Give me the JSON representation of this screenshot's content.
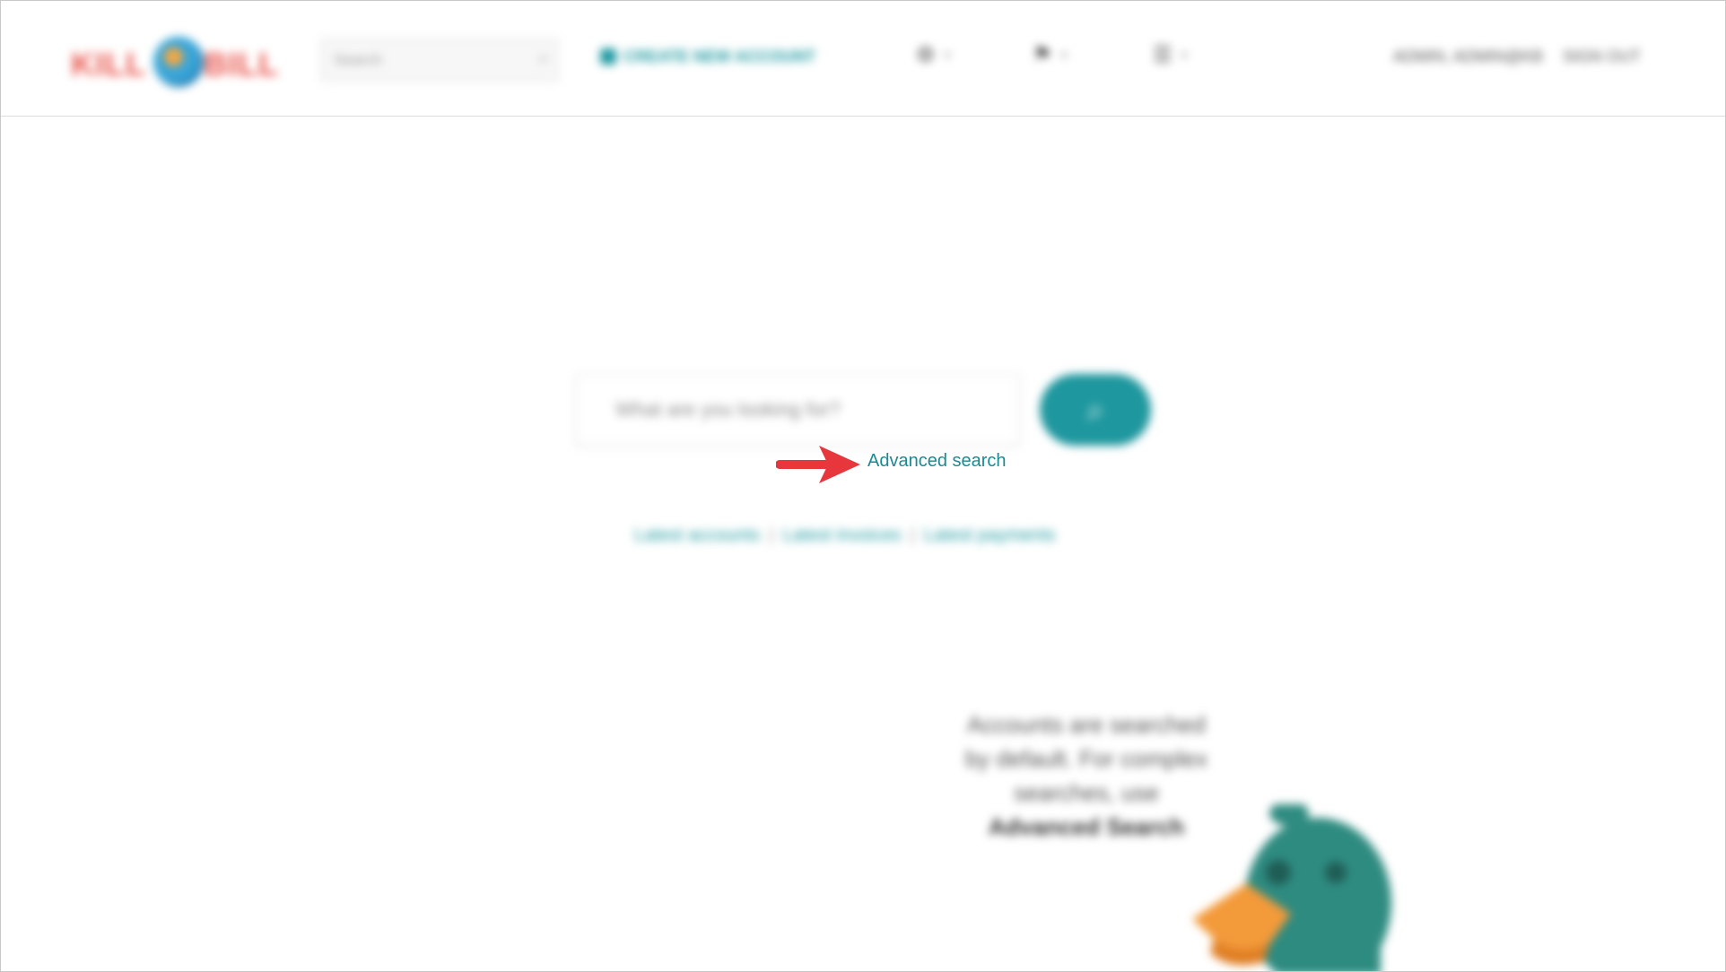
{
  "header": {
    "logo_left": "KILL",
    "logo_right": "BILL",
    "search_placeholder": "Search",
    "create_account_label": "CREATE NEW ACCOUNT",
    "user_label": "ADMIN, ADMIN@KB",
    "logout_label": "SIGN OUT"
  },
  "main": {
    "search_placeholder": "What are you looking for?",
    "advanced_search_label": "Advanced search",
    "quick_links": [
      "Latest accounts",
      "Latest invoices",
      "Latest payments"
    ],
    "tip_lines": [
      "Accounts are searched",
      "by default. For complex",
      "searches, use"
    ],
    "tip_link": "Advanced Search"
  },
  "colors": {
    "accent": "#1e979e",
    "link": "#1b8a92",
    "annotation_arrow": "#e8363d",
    "logo": "#e8574e"
  },
  "icons": {
    "header_search": "search-icon",
    "main_search": "search-icon",
    "nav_1": "gear-icon",
    "nav_2": "tag-icon",
    "nav_3": "sliders-icon"
  }
}
